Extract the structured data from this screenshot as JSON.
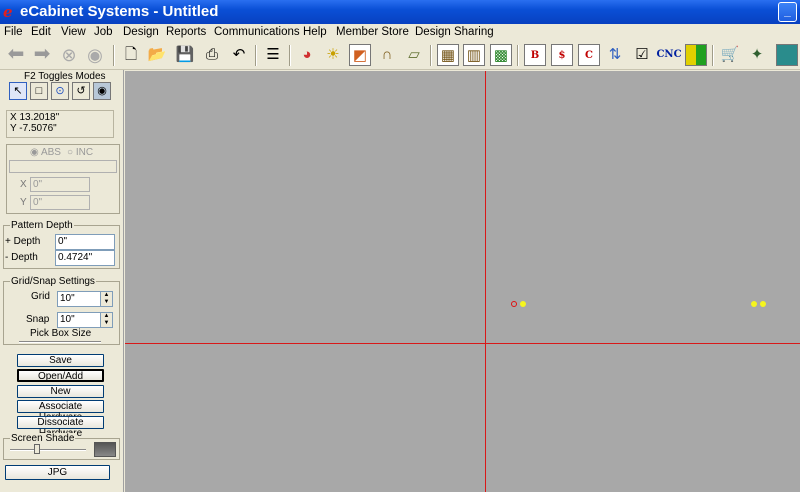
{
  "window": {
    "title": "eCabinet Systems - Untitled",
    "minimize_glyph": "_"
  },
  "menu": [
    "File",
    "Edit",
    "View",
    "Job",
    "Design",
    "Reports",
    "Communications",
    "Help",
    "Member Store",
    "Design Sharing"
  ],
  "toolbar": {
    "cnc_label": "CNC",
    "b_label": "B",
    "s_label": "$",
    "c_label": "C"
  },
  "sidebar": {
    "modes_label": "F2 Toggles Modes",
    "coords": {
      "x": "X 13.2018\"",
      "y": "Y -7.5076\""
    },
    "mode": {
      "abs": "ABS",
      "inc": "INC"
    },
    "entry": {
      "x_label": "X",
      "x_value": "0\"",
      "y_label": "Y",
      "y_value": "0\""
    },
    "pattern": {
      "title": "Pattern Depth",
      "plus_label": "+ Depth",
      "plus_value": "0\"",
      "minus_label": "- Depth",
      "minus_value": "0.4724\""
    },
    "grid": {
      "title": "Grid/Snap Settings",
      "grid_label": "Grid",
      "grid_value": "10\"",
      "snap_label": "Snap",
      "snap_value": "10\"",
      "pickbox_label": "Pick Box Size"
    },
    "buttons": {
      "save": "Save",
      "open_add": "Open/Add",
      "new": "New",
      "associate": "Associate Hardware",
      "dissociate": "Dissociate Hardware",
      "jpg": "JPG"
    },
    "shade_label": "Screen Shade"
  },
  "colors": {
    "canvas_bg": "#a8a8a8",
    "axis": "#d81818",
    "point_yellow": "#f5f51e",
    "point_red": "#e01010"
  }
}
